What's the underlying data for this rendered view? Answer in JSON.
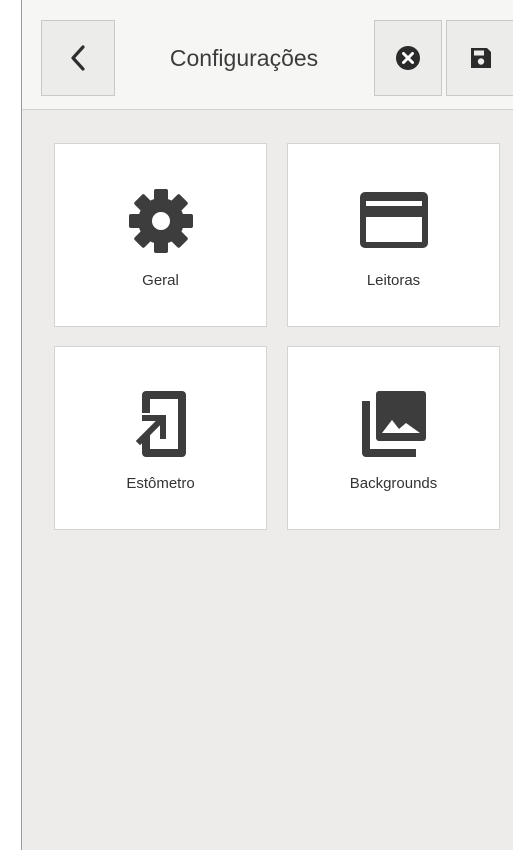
{
  "header": {
    "title": "Configurações",
    "back_icon": "chevron-left-icon",
    "cancel_icon": "close-circle-icon",
    "save_icon": "floppy-disk-icon"
  },
  "tiles": [
    {
      "label": "Geral",
      "icon": "gear-icon"
    },
    {
      "label": "Leitoras",
      "icon": "credit-card-icon"
    },
    {
      "label": "Estômetro",
      "icon": "device-login-icon"
    },
    {
      "label": "Backgrounds",
      "icon": "image-gallery-icon"
    }
  ],
  "colors": {
    "icon": "#3d3d3d",
    "background": "#edeceb",
    "tile": "#ffffff"
  }
}
